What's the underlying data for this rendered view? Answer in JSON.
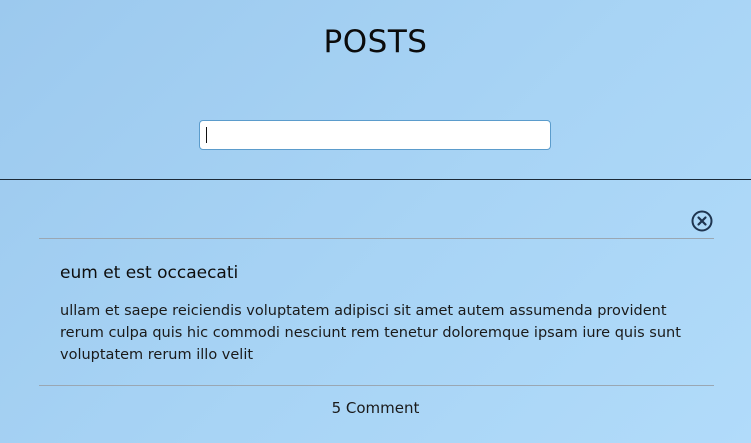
{
  "header": {
    "title": "POSTS"
  },
  "search": {
    "value": "",
    "placeholder": ""
  },
  "post": {
    "title": "eum et est occaecati",
    "body": "ullam et saepe reiciendis voluptatem adipisci sit amet autem assumenda provident rerum culpa quis hic commodi nesciunt rem tenetur doloremque ipsam iure quis sunt voluptatem rerum illo velit",
    "comments_label": "5 Comment",
    "close_icon": "close-circle-icon"
  },
  "colors": {
    "background": "#a8d4f5",
    "input_border": "#5b9ccc",
    "icon": "#1f3550"
  }
}
